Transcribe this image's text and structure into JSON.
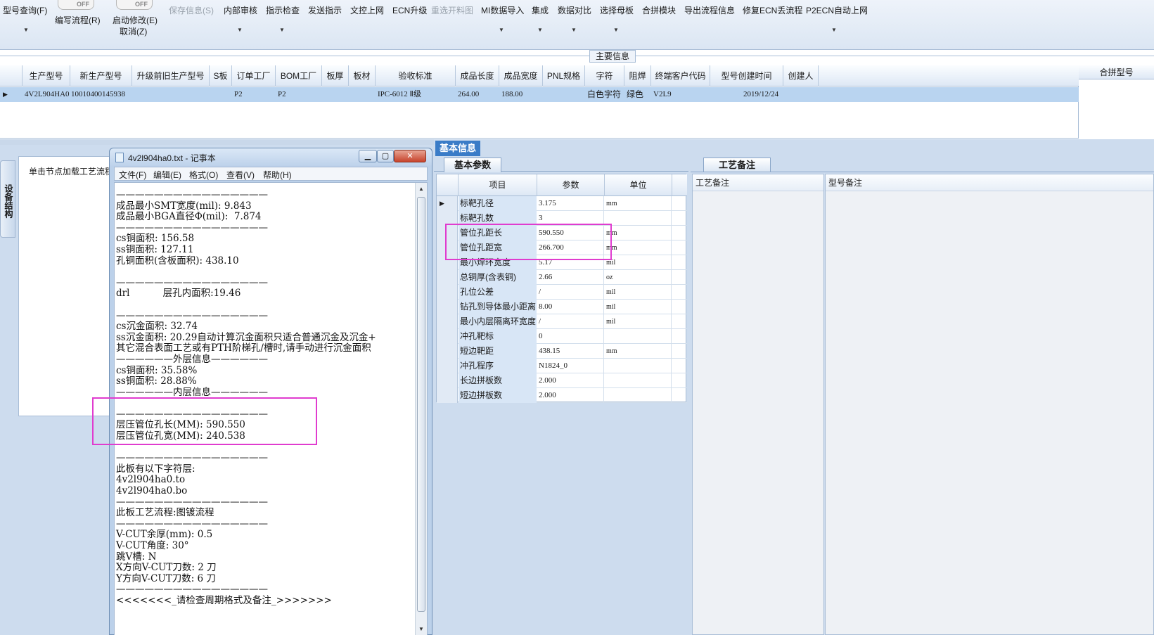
{
  "toolbar": {
    "row1": [
      {
        "label": "型号查询(F)",
        "disabled": false
      },
      {
        "label": "保存信息(S)",
        "disabled": true
      },
      {
        "label": "内部审核",
        "disabled": false
      },
      {
        "label": "指示检查",
        "disabled": false
      },
      {
        "label": "发送指示",
        "disabled": false
      },
      {
        "label": "文控上网",
        "disabled": false
      },
      {
        "label": "ECN升级",
        "disabled": false
      },
      {
        "label": "重选开料图",
        "disabled": true
      },
      {
        "label": "MI数据导入",
        "disabled": false
      },
      {
        "label": "集成",
        "disabled": false
      },
      {
        "label": "数据对比",
        "disabled": false
      },
      {
        "label": "选择母板",
        "disabled": false
      },
      {
        "label": "合拼模块",
        "disabled": false
      },
      {
        "label": "导出流程信息",
        "disabled": false
      },
      {
        "label": "修复ECN丢流程",
        "disabled": false
      },
      {
        "label": "P2ECN自动上网",
        "disabled": false
      }
    ],
    "toggle_label": "OFF",
    "write_flow": "编写流程(R)",
    "start_modify": "启动修改(E)",
    "cancel": "取消(Z)"
  },
  "main_info": {
    "title": "主要信息",
    "columns": [
      "生产型号",
      "新生产型号",
      "升级前旧生产型号",
      "S板",
      "订单工厂",
      "BOM工厂",
      "板厚",
      "板材",
      "验收标准",
      "成品长度",
      "成品宽度",
      "PNL规格",
      "字符",
      "阻焊",
      "终端客户代码",
      "型号创建时间",
      "创建人"
    ],
    "row": [
      "4V2L904HA0",
      "10010400145938",
      "",
      "",
      "P2",
      "P2",
      "",
      "",
      "IPC-6012 Ⅱ级",
      "264.00",
      "188.00",
      "",
      "白色字符",
      "绿色",
      "V2L9",
      "2019/12/24",
      ""
    ],
    "combined_header": "合拼型号"
  },
  "left": {
    "vertical_tab": "设备结构",
    "panel_label": "单击节点加载工艺流程"
  },
  "notepad": {
    "title": "4v2l904ha0.txt - 记事本",
    "menu": [
      "文件(F)",
      "编辑(E)",
      "格式(O)",
      "查看(V)",
      "帮助(H)"
    ],
    "lines": [
      "————————————————",
      "成品最小SMT宽度(mil): 9.843",
      "成品最小BGA直径Φ(mil):  7.874",
      "————————————————",
      "cs铜面积: 156.58",
      "ss铜面积: 127.11",
      "孔铜面积(含板面积): 438.10",
      "",
      "————————————————",
      "drl           层孔内面积:19.46",
      "",
      "————————————————",
      "cs沉金面积: 32.74",
      "ss沉金面积: 20.29自动计算沉金面积只适合普通沉金及沉金+",
      "其它混合表面工艺或有PTH阶梯孔/槽时,请手动进行沉金面积",
      "——————外层信息——————",
      "cs铜面积: 35.58%",
      "ss铜面积: 28.88%",
      "——————内层信息——————",
      "",
      "————————————————",
      "层压管位孔长(MM): 590.550",
      "层压管位孔宽(MM): 240.538",
      "",
      "————————————————",
      "此板有以下字符层:",
      "4v2l904ha0.to",
      "4v2l904ha0.bo",
      "————————————————",
      "此板工艺流程:图镀流程",
      "————————————————",
      "V-CUT余厚(mm): 0.5",
      "V-CUT角度: 30°",
      "跳V槽: N",
      "X方向V-CUT刀数: 2 刀",
      "Y方向V-CUT刀数: 6 刀",
      "————————————————",
      "<<<<<<<_请检查周期格式及备注_>>>>>>>"
    ]
  },
  "basic_info": {
    "tab_label": "基本信息",
    "sub_tab": "基本参数",
    "headers": [
      "项目",
      "参数",
      "单位"
    ],
    "rows": [
      {
        "item": "标靶孔径",
        "value": "3.175",
        "unit": "mm"
      },
      {
        "item": "标靶孔数",
        "value": "3",
        "unit": ""
      },
      {
        "item": "管位孔距长",
        "value": "590.550",
        "unit": "mm"
      },
      {
        "item": "管位孔距宽",
        "value": "266.700",
        "unit": "mm"
      },
      {
        "item": "最小焊环宽度",
        "value": "5.17",
        "unit": "mil"
      },
      {
        "item": "总铜厚(含表铜)",
        "value": "2.66",
        "unit": "oz"
      },
      {
        "item": "孔位公差",
        "value": "/",
        "unit": "mil"
      },
      {
        "item": "钻孔到导体最小距离",
        "value": "8.00",
        "unit": "mil"
      },
      {
        "item": "最小内层隔离环宽度",
        "value": "/",
        "unit": "mil"
      },
      {
        "item": "冲孔靶标",
        "value": "0",
        "unit": ""
      },
      {
        "item": "短边靶距",
        "value": "438.15",
        "unit": "mm"
      },
      {
        "item": "冲孔程序",
        "value": "N1824_0",
        "unit": ""
      },
      {
        "item": "长边拼板数",
        "value": "2.000",
        "unit": ""
      },
      {
        "item": "短边拼板数",
        "value": "2.000",
        "unit": ""
      }
    ]
  },
  "craft": {
    "tab_label": "工艺备注",
    "col1": "工艺备注",
    "col2": "型号备注"
  },
  "colors": {
    "highlight": "#e03ccf",
    "selected_row": "#b9d4f0",
    "tab_active": "#3a7cc7"
  }
}
